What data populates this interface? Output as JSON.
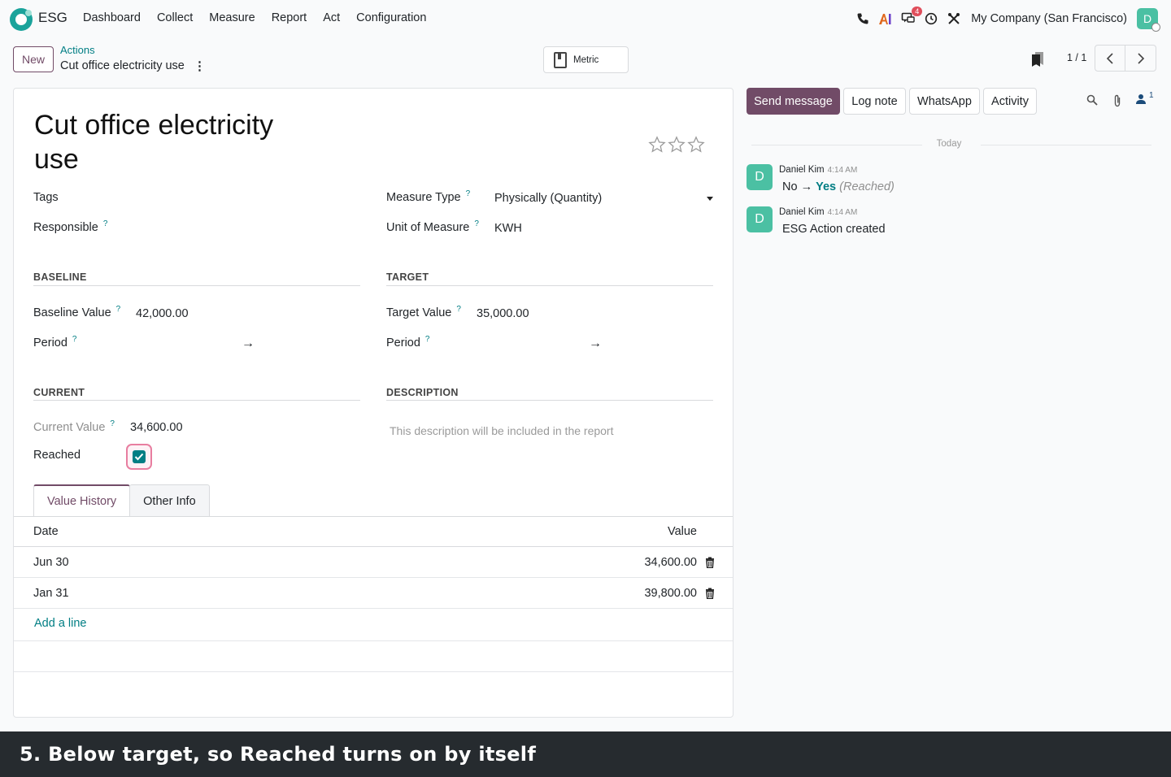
{
  "app": {
    "name": "ESG",
    "menu": [
      "Dashboard",
      "Collect",
      "Measure",
      "Report",
      "Act",
      "Configuration"
    ],
    "company": "My Company (San Francisco)",
    "user_initial": "D",
    "messages_badge": "4"
  },
  "control": {
    "new_label": "New",
    "breadcrumb_parent": "Actions",
    "breadcrumb_current": "Cut office electricity use",
    "smart_button": "Metric",
    "pager": "1 / 1"
  },
  "form": {
    "title": "Cut office electricity use",
    "tags_label": "Tags",
    "responsible_label": "Responsible",
    "measure_type_label": "Measure Type",
    "measure_type_value": "Physically (Quantity)",
    "uom_label": "Unit of Measure",
    "uom_value": "KWH",
    "baseline_heading": "BASELINE",
    "baseline_value_label": "Baseline Value",
    "baseline_value": "42,000.00",
    "baseline_period_label": "Period",
    "target_heading": "TARGET",
    "target_value_label": "Target Value",
    "target_value": "35,000.00",
    "target_period_label": "Period",
    "current_heading": "CURRENT",
    "current_value_label": "Current Value",
    "current_value": "34,600.00",
    "reached_label": "Reached",
    "reached": true,
    "description_heading": "DESCRIPTION",
    "description_placeholder": "This description will be included in the report",
    "tabs": [
      "Value History",
      "Other Info"
    ],
    "history_headers": {
      "date": "Date",
      "value": "Value"
    },
    "history_rows": [
      {
        "date": "Jun 30",
        "value": "34,600.00"
      },
      {
        "date": "Jan 31",
        "value": "39,800.00"
      }
    ],
    "add_line": "Add a line"
  },
  "chatter": {
    "send_message": "Send message",
    "log_note": "Log note",
    "whatsapp": "WhatsApp",
    "activity": "Activity",
    "followers_count": "1",
    "date_divider": "Today",
    "messages": [
      {
        "initial": "D",
        "author": "Daniel Kim",
        "time": "4:14 AM",
        "old": "No",
        "arrow": "→",
        "new": "Yes",
        "field": "(Reached)"
      },
      {
        "initial": "D",
        "author": "Daniel Kim",
        "time": "4:14 AM",
        "body": "ESG Action created"
      }
    ]
  },
  "caption": "5. Below target, so Reached turns on by itself",
  "colors": {
    "brand": "#714b67",
    "accent": "#017e84",
    "avatar": "#4bc0a3",
    "caption_bg": "#262b2f"
  }
}
